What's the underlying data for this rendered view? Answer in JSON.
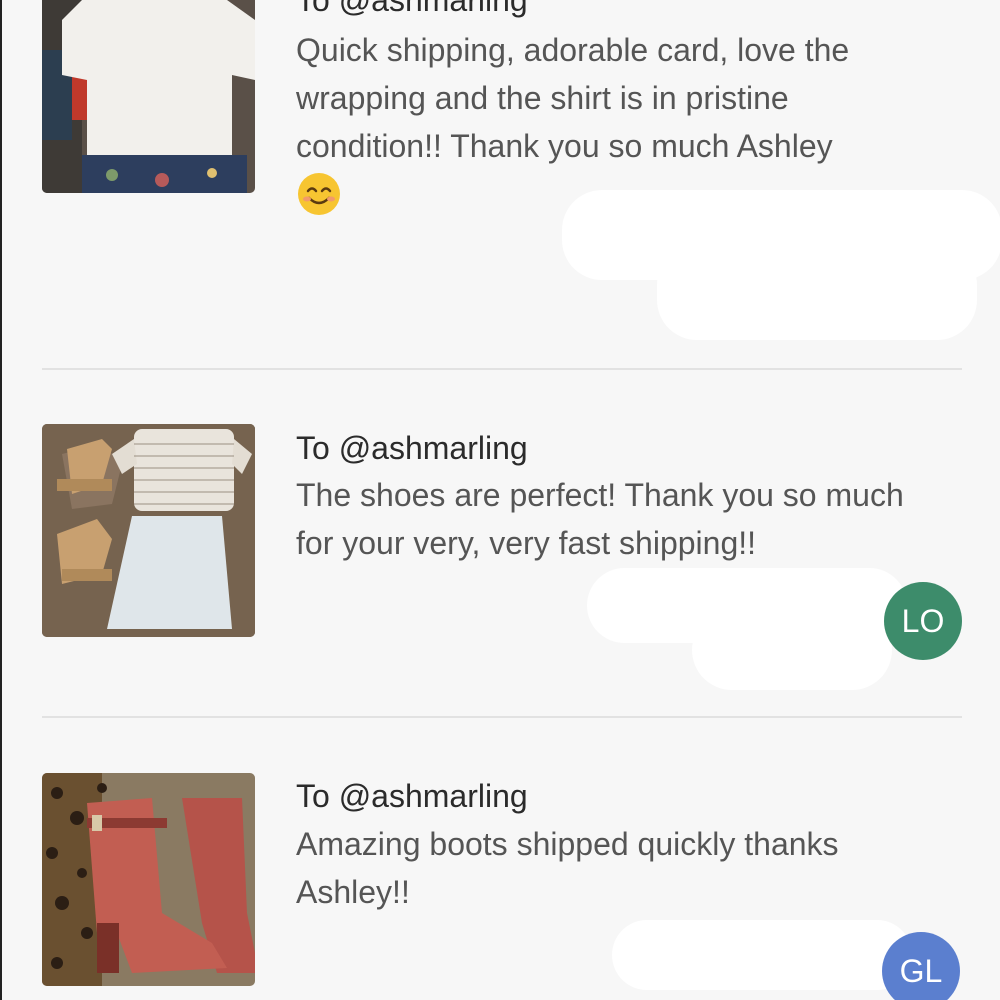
{
  "reviews": [
    {
      "title": "To @ashmarling",
      "body": "Quick shipping, adorable card, love the wrapping and the shirt is in pristine condition!! Thank you so much Ashley",
      "emoji": "smiling-face-icon",
      "avatar": null
    },
    {
      "title": "To @ashmarling",
      "body": "The shoes are perfect! Thank you so much for your very, very fast shipping!!",
      "avatar": {
        "initials": "LO",
        "color": "#3d8c6b"
      }
    },
    {
      "title": "To @ashmarling",
      "body": "Amazing boots shipped quickly thanks Ashley!!",
      "avatar": {
        "initials": "GL",
        "color": "#5b7fcf"
      }
    }
  ],
  "colors": {
    "background": "#f7f7f7",
    "divider": "#e2e2e2",
    "title_text": "#2b2b2b",
    "body_text": "#555555"
  }
}
